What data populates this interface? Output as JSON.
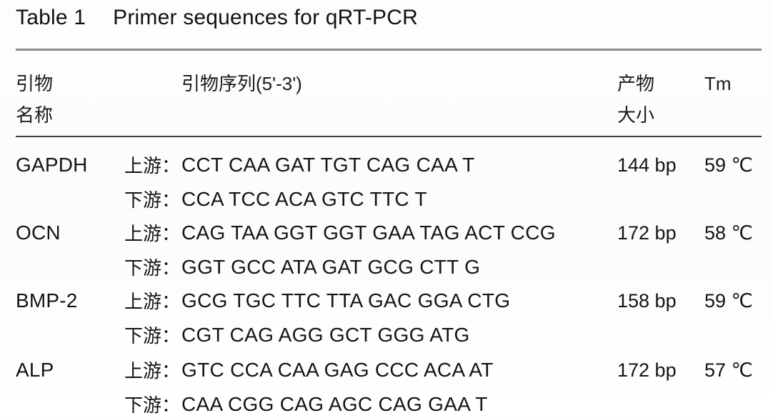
{
  "caption": {
    "label": "Table 1",
    "title": "Primer sequences for qRT-PCR"
  },
  "header": {
    "primer_name_line1": "引物",
    "primer_name_line2": "名称",
    "sequence": "引物序列(5'-3')",
    "product_size_line1": "产物",
    "product_size_line2": "大小",
    "tm": "Tm"
  },
  "direction_labels": {
    "forward": "上游：",
    "reverse": "下游："
  },
  "rows": [
    {
      "gene": "GAPDH",
      "forward_label": "上游：",
      "forward_seq": "CCT CAA GAT TGT CAG CAA T",
      "reverse_label": "下游：",
      "reverse_seq": "CCA TCC ACA GTC TTC T",
      "product_size": "144 bp",
      "tm": "59 ℃"
    },
    {
      "gene": "OCN",
      "forward_label": "上游：",
      "forward_seq": "CAG TAA GGT GGT GAA TAG ACT CCG",
      "reverse_label": "下游：",
      "reverse_seq": "GGT GCC ATA GAT GCG CTT G",
      "product_size": "172 bp",
      "tm": "58 ℃"
    },
    {
      "gene": "BMP-2",
      "forward_label": "上游：",
      "forward_seq": "GCG TGC TTC TTA GAC GGA CTG",
      "reverse_label": "下游：",
      "reverse_seq": "CGT CAG AGG GCT GGG ATG",
      "product_size": "158 bp",
      "tm": "59 ℃"
    },
    {
      "gene": "ALP",
      "forward_label": "上游：",
      "forward_seq": "GTC CCA CAA GAG CCC ACA AT",
      "reverse_label": "下游：",
      "reverse_seq": "CAA CGG CAG AGC CAG GAA T",
      "product_size": "172 bp",
      "tm": "57 ℃"
    }
  ],
  "colors": {
    "rule_top": "#8b8b91",
    "rule_header": "#3f3f45",
    "text": "#141414",
    "background": "#fdfdfe"
  }
}
